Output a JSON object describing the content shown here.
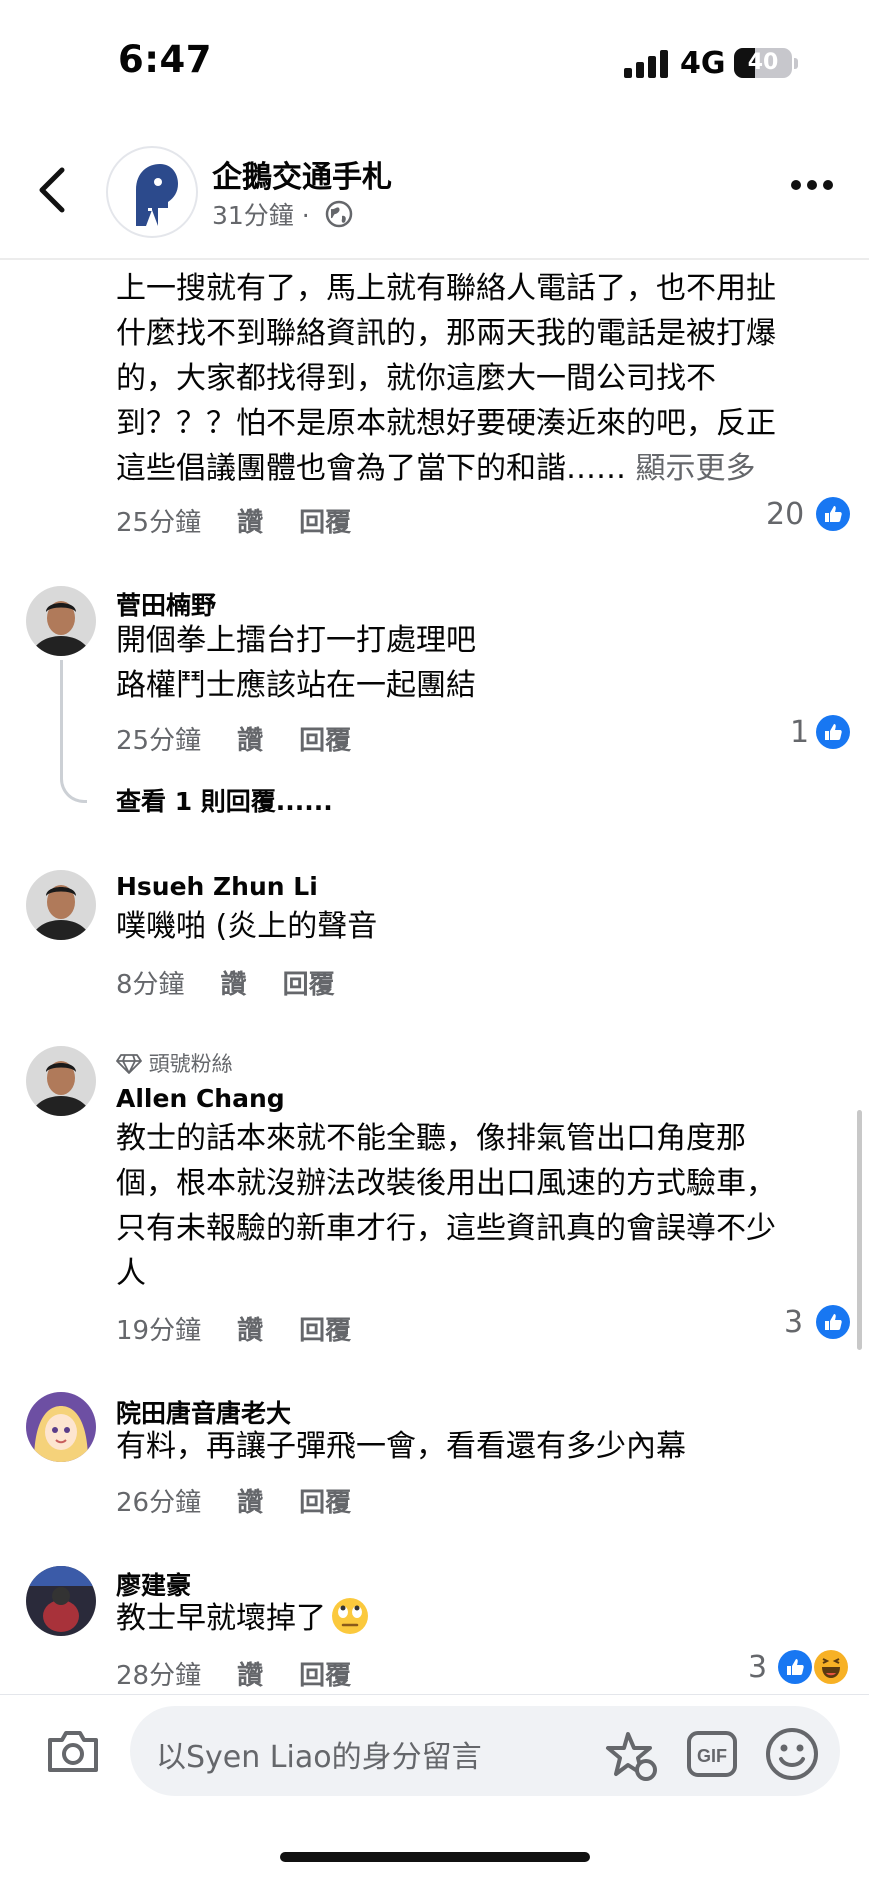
{
  "status": {
    "time": "6:47",
    "network": "4G",
    "battery": "40"
  },
  "header": {
    "page_name": "企鵝交通手札",
    "time_ago": "31分鐘 ·"
  },
  "comments": [
    {
      "lines": [
        "上一搜就有了，馬上就有聯絡人電話了，也不用扯",
        "什麼找不到聯絡資訊的，那兩天我的電話是被打爆",
        "的，大家都找得到，就你這麼大一間公司找不",
        "到？？？怕不是原本就想好要硬湊近來的吧，反正",
        "這些倡議團體也會為了當下的和諧……"
      ],
      "see_more": "顯示更多",
      "time": "25分鐘",
      "like": "讚",
      "reply": "回覆",
      "likes": "20"
    },
    {
      "author": "菅田楠野",
      "lines": [
        "開個拳上擂台打一打處理吧",
        "路權鬥士應該站在一起團結"
      ],
      "time": "25分鐘",
      "like": "讚",
      "reply": "回覆",
      "likes": "1",
      "view_replies": "查看 1 則回覆......"
    },
    {
      "author": "Hsueh Zhun Li",
      "lines": [
        "噗嘰啪 (炎上的聲音"
      ],
      "time": "8分鐘",
      "like": "讚",
      "reply": "回覆"
    },
    {
      "badge": "頭號粉絲",
      "author": "Allen  Chang",
      "lines": [
        "教士的話本來就不能全聽，像排氣管出口角度那",
        "個，根本就沒辦法改裝後用出口風速的方式驗車，",
        "只有未報驗的新車才行，這些資訊真的會誤導不少",
        "人"
      ],
      "time": "19分鐘",
      "like": "讚",
      "reply": "回覆",
      "likes": "3"
    },
    {
      "author": "院田唐音唐老大",
      "lines": [
        "有料，再讓子彈飛一會，看看還有多少內幕"
      ],
      "time": "26分鐘",
      "like": "讚",
      "reply": "回覆"
    },
    {
      "author": "廖建豪",
      "lines": [
        "教士早就壞掉了"
      ],
      "time": "28分鐘",
      "like": "讚",
      "reply": "回覆",
      "likes": "3"
    }
  ],
  "composer": {
    "placeholder": "以Syen  Liao的身分留言",
    "gif": "GIF"
  },
  "colors": {
    "accent": "#1877f2",
    "secondary_text": "#65676b",
    "input_bg": "#f0f2f5"
  }
}
